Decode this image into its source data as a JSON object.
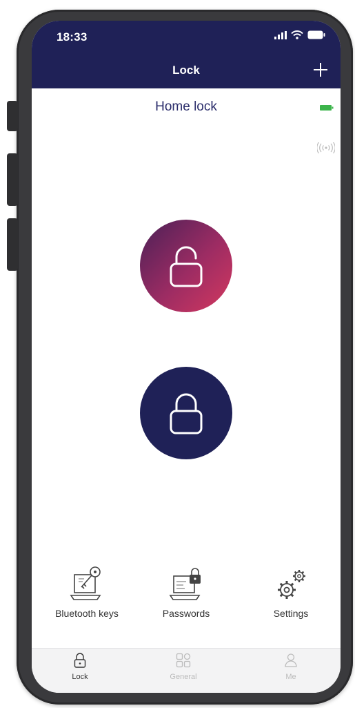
{
  "status_bar": {
    "time": "18:33"
  },
  "header": {
    "title": "Lock",
    "add_icon": "plus-icon"
  },
  "lock": {
    "name": "Home lock",
    "battery_color": "#3cb44b",
    "unlock_icon": "unlocked-padlock-icon",
    "lock_icon": "locked-padlock-icon"
  },
  "features": [
    {
      "label": "Bluetooth keys",
      "icon": "bluetooth-key-icon"
    },
    {
      "label": "Passwords",
      "icon": "password-laptop-icon"
    },
    {
      "label": "Settings",
      "icon": "gears-icon"
    }
  ],
  "tabs": [
    {
      "label": "Lock",
      "icon": "lock-tab-icon",
      "active": true
    },
    {
      "label": "General",
      "icon": "grid-icon",
      "active": false
    },
    {
      "label": "Me",
      "icon": "person-icon",
      "active": false
    }
  ],
  "colors": {
    "header_bg": "#1f2157",
    "accent_gradient_start": "#4a2057",
    "accent_gradient_end": "#d4385f",
    "lock_button": "#1f2157"
  }
}
